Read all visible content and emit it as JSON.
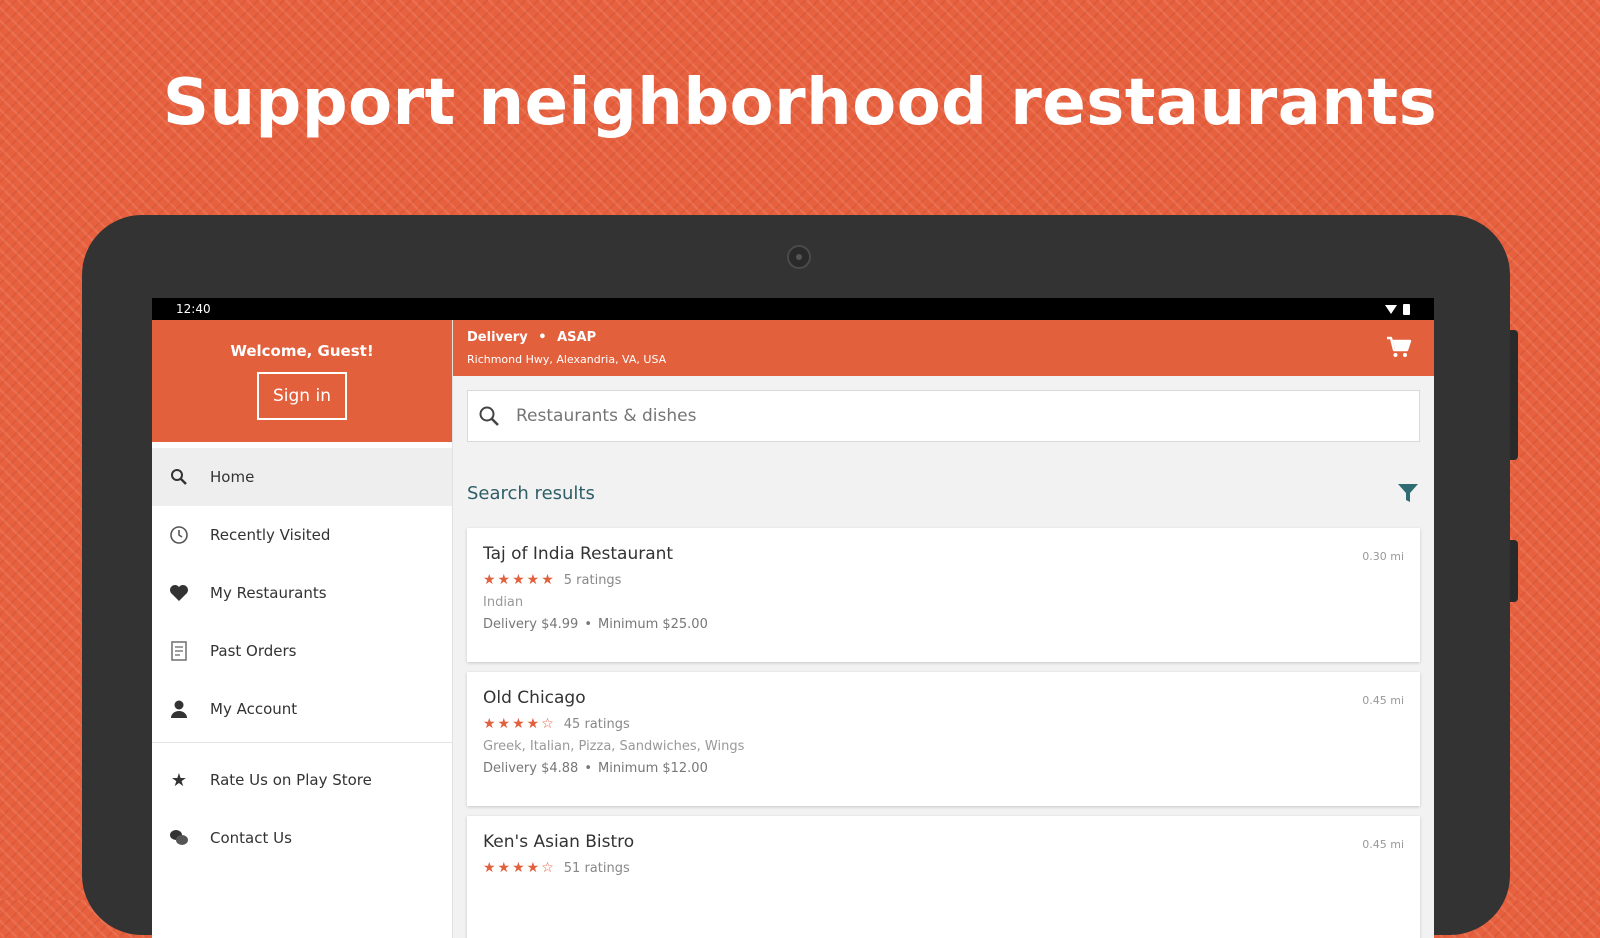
{
  "headline": "Support neighborhood restaurants",
  "status_bar": {
    "time": "12:40"
  },
  "drawer": {
    "welcome": "Welcome, Guest!",
    "sign_in_label": "Sign in",
    "items": [
      {
        "label": "Home",
        "icon": "search-icon"
      },
      {
        "label": "Recently Visited",
        "icon": "clock-icon"
      },
      {
        "label": "My Restaurants",
        "icon": "heart-icon"
      },
      {
        "label": "Past Orders",
        "icon": "receipt-icon"
      },
      {
        "label": "My Account",
        "icon": "person-icon"
      },
      {
        "label": "Rate Us on Play Store",
        "icon": "star-icon"
      },
      {
        "label": "Contact Us",
        "icon": "chat-icon"
      }
    ]
  },
  "appbar": {
    "mode": "Delivery",
    "separator": "•",
    "timing": "ASAP",
    "address": "Richmond Hwy, Alexandria, VA, USA"
  },
  "search": {
    "placeholder": "Restaurants & dishes"
  },
  "results": {
    "title": "Search results",
    "restaurants": [
      {
        "name": "Taj of India Restaurant",
        "distance": "0.30 mi",
        "stars": "★★★★★",
        "ratings": "5 ratings",
        "cuisine": "Indian",
        "delivery": "Delivery $4.99",
        "minimum": "Minimum $25.00"
      },
      {
        "name": "Old Chicago",
        "distance": "0.45 mi",
        "stars": "★★★★☆",
        "ratings": "45 ratings",
        "cuisine": "Greek, Italian, Pizza, Sandwiches, Wings",
        "delivery": "Delivery $4.88",
        "minimum": "Minimum $12.00"
      },
      {
        "name": "Ken's Asian Bistro",
        "distance": "0.45 mi",
        "stars": "★★★★☆",
        "ratings": "51 ratings",
        "cuisine": "",
        "delivery": "",
        "minimum": ""
      }
    ]
  },
  "colors": {
    "brand": "#e3603d",
    "background": "#e8613f",
    "device": "#333333",
    "heading_teal": "#2e5e66"
  }
}
